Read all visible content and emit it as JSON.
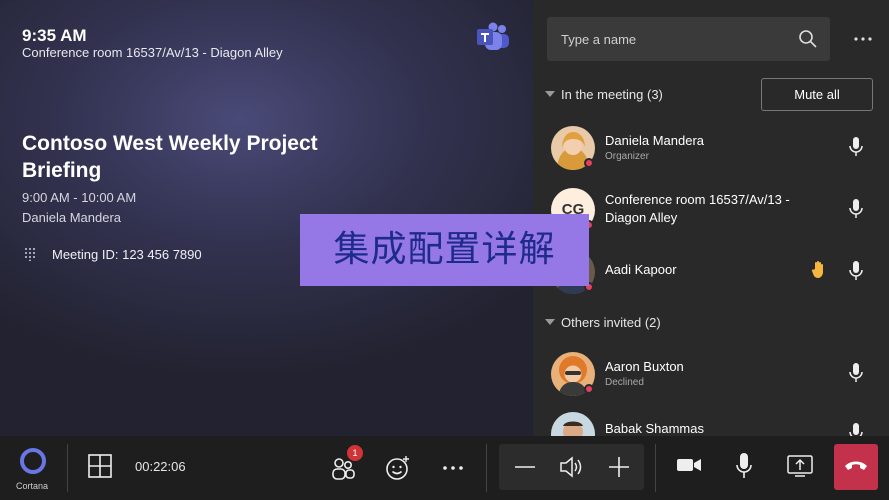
{
  "stage": {
    "time": "9:35 AM",
    "room": "Conference room 16537/Av/13 - Diagon Alley",
    "meeting_title": "Contoso West Weekly Project Briefing",
    "meeting_time": "9:00 AM - 10:00 AM",
    "organizer": "Daniela Mandera",
    "meeting_id": "Meeting ID: 123 456 7890",
    "banner": "集成配置详解"
  },
  "panel": {
    "search_placeholder": "Type a name",
    "in_meeting_label": "In the meeting (3)",
    "mute_all_label": "Mute all",
    "others_label": "Others invited (2)",
    "in_meeting": [
      {
        "name": "Daniela Mandera",
        "role": "Organizer",
        "avatar": "photo",
        "hand_raised": false
      },
      {
        "name": "Conference room 16537/Av/13 - Diagon Alley",
        "role": "",
        "avatar": "CG",
        "hand_raised": false
      },
      {
        "name": "Aadi Kapoor",
        "role": "",
        "avatar": "photo",
        "hand_raised": true
      }
    ],
    "others": [
      {
        "name": "Aaron Buxton",
        "role": "Declined",
        "avatar": "photo"
      },
      {
        "name": "Babak Shammas",
        "role": "",
        "avatar": "photo"
      }
    ]
  },
  "bar": {
    "cortana_label": "Cortana",
    "elapsed": "00:22:06",
    "participants_badge": "1"
  },
  "colors": {
    "accent": "#6264a7",
    "banner": "#9577e6",
    "hangup": "#c4314b",
    "presence_busy": "#e4405f"
  }
}
